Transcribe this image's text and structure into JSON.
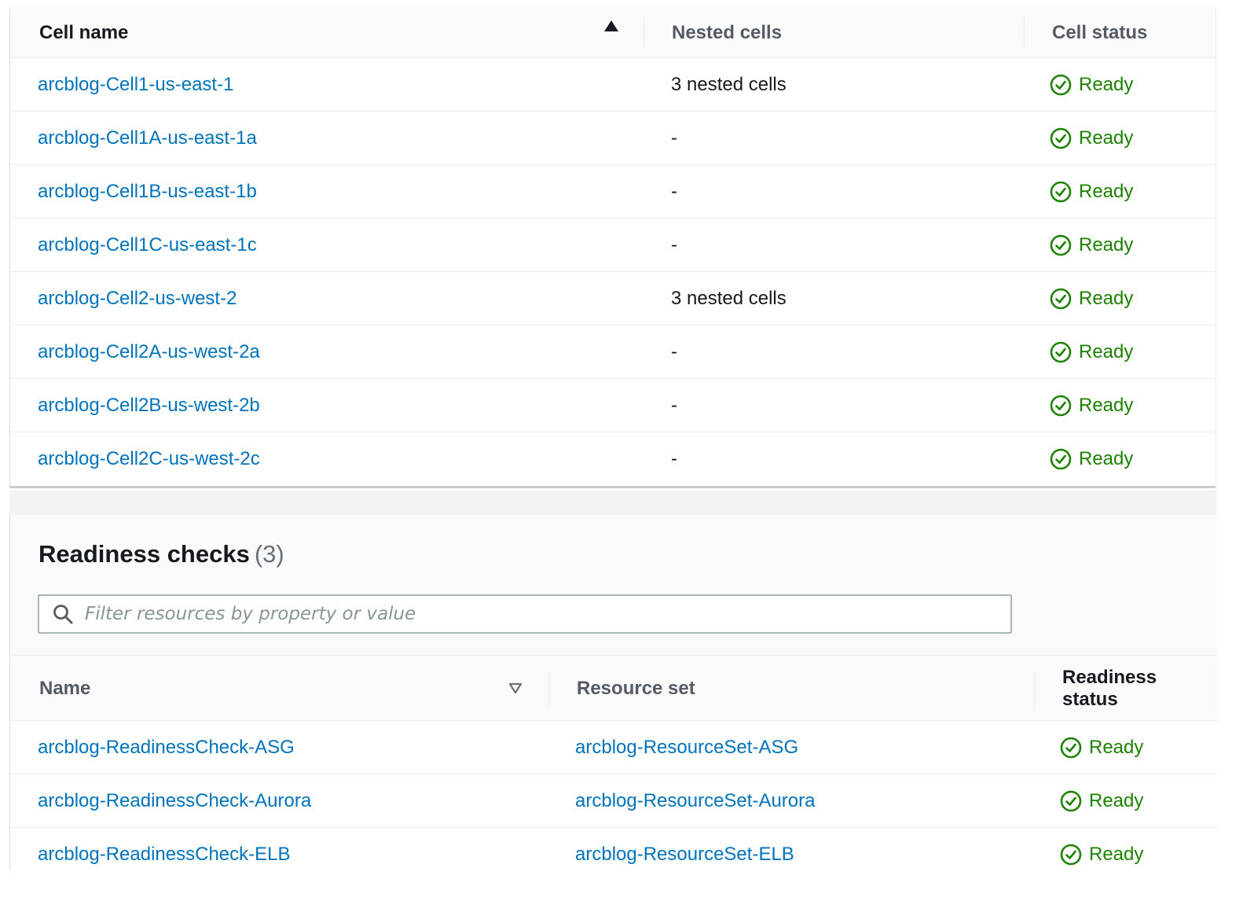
{
  "cells_table": {
    "columns": {
      "name": "Cell name",
      "nested": "Nested cells",
      "status": "Cell status"
    },
    "rows": [
      {
        "name": "arcblog-Cell1-us-east-1",
        "nested": "3 nested cells",
        "status": "Ready"
      },
      {
        "name": "arcblog-Cell1A-us-east-1a",
        "nested": "-",
        "status": "Ready"
      },
      {
        "name": "arcblog-Cell1B-us-east-1b",
        "nested": "-",
        "status": "Ready"
      },
      {
        "name": "arcblog-Cell1C-us-east-1c",
        "nested": "-",
        "status": "Ready"
      },
      {
        "name": "arcblog-Cell2-us-west-2",
        "nested": "3 nested cells",
        "status": "Ready"
      },
      {
        "name": "arcblog-Cell2A-us-west-2a",
        "nested": "-",
        "status": "Ready"
      },
      {
        "name": "arcblog-Cell2B-us-west-2b",
        "nested": "-",
        "status": "Ready"
      },
      {
        "name": "arcblog-Cell2C-us-west-2c",
        "nested": "-",
        "status": "Ready"
      }
    ]
  },
  "readiness_checks": {
    "title": "Readiness checks",
    "count": "(3)",
    "filter": {
      "placeholder": "Filter resources by property or value",
      "value": ""
    },
    "columns": {
      "name": "Name",
      "resource_set": "Resource set",
      "status": "Readiness status"
    },
    "rows": [
      {
        "name": "arcblog-ReadinessCheck-ASG",
        "resource_set": "arcblog-ResourceSet-ASG",
        "status": "Ready"
      },
      {
        "name": "arcblog-ReadinessCheck-Aurora",
        "resource_set": "arcblog-ResourceSet-Aurora",
        "status": "Ready"
      },
      {
        "name": "arcblog-ReadinessCheck-ELB",
        "resource_set": "arcblog-ResourceSet-ELB",
        "status": "Ready"
      }
    ]
  },
  "icons": {
    "status_ok": "check-circle-icon",
    "search": "search-icon",
    "sort_ascending": "sort-ascending-icon",
    "sort_descending": "sort-descending-icon"
  },
  "colors": {
    "link": "#0073bb",
    "success": "#1d8102",
    "text": "#16191f",
    "header_muted": "#545b64",
    "border": "#eaeded"
  }
}
